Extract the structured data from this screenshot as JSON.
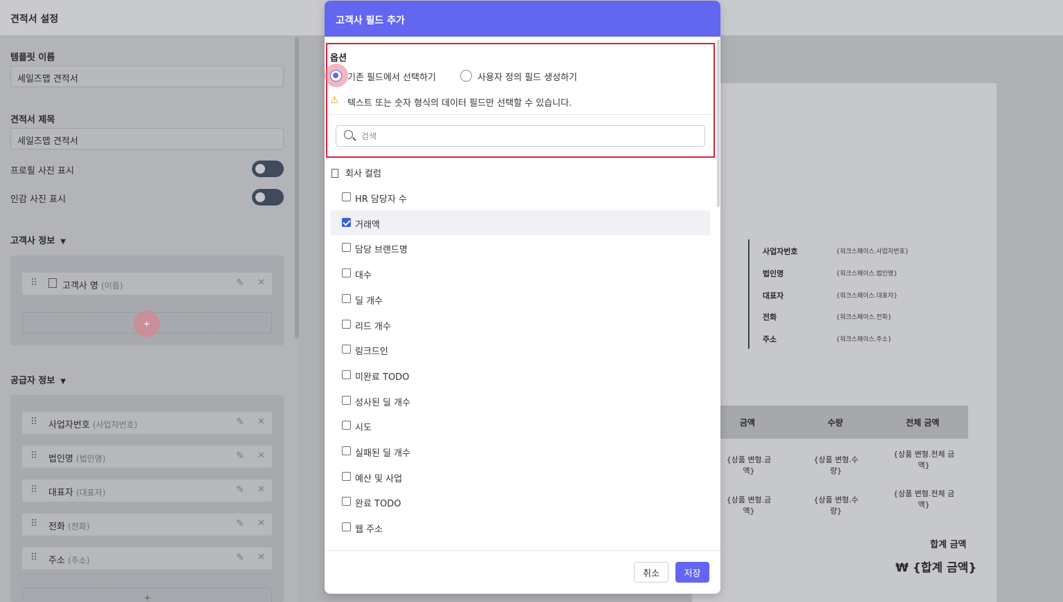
{
  "app": {
    "title": "견적서 설정"
  },
  "left": {
    "template_name_label": "템플릿 이름",
    "template_name_value": "세일즈맵 견적서",
    "quote_title_label": "견적서 제목",
    "quote_title_value": "세일즈맵 견적서",
    "toggles": [
      "프로필 사진 표시",
      "인감 사진 표시"
    ],
    "customer_section": "고객사 정보",
    "customer_fields": [
      {
        "label": "고객사 명",
        "sub": "(이름)"
      }
    ],
    "supplier_section": "공급자 정보",
    "supplier_fields": [
      {
        "label": "사업자번호",
        "sub": "(사업자번호)"
      },
      {
        "label": "법인명",
        "sub": "(법인명)"
      },
      {
        "label": "대표자",
        "sub": "(대표자)"
      },
      {
        "label": "전화",
        "sub": "(전화)"
      },
      {
        "label": "주소",
        "sub": "(주소)"
      }
    ],
    "add_symbol": "+"
  },
  "preview": {
    "supplier_info": [
      {
        "label": "사업자번호",
        "value": "{워크스페이스.사업자번호}"
      },
      {
        "label": "법인명",
        "value": "{워크스페이스.법인명}"
      },
      {
        "label": "대표자",
        "value": "{워크스페이스.대표자}"
      },
      {
        "label": "전화",
        "value": "{워크스페이스.전화}"
      },
      {
        "label": "주소",
        "value": "{워크스페이스.주소}"
      }
    ],
    "table_headers": [
      "금액",
      "수량",
      "전체 금액"
    ],
    "table_rows": [
      [
        "{상품 변형.금액}",
        "{상품 변형.수량}",
        "{상품 변형.전체 금액}"
      ],
      [
        "{상품 변형.금액}",
        "{상품 변형.수량}",
        "{상품 변형.전체 금액}"
      ]
    ],
    "total_label": "합계 금액",
    "total_value": "₩ {합계 금액}"
  },
  "modal": {
    "title": "고객사 필드 추가",
    "options_label": "옵션",
    "radio_existing": "기존 필드에서 선택하기",
    "radio_custom": "사용자 정의 필드 생성하기",
    "warning": "텍스트 또는 숫자 형식의 데이터 필드만 선택할 수 있습니다.",
    "search_placeholder": "검색",
    "group_label": "회사 컬럼",
    "items": [
      {
        "label": "HR 담당자 수",
        "checked": false
      },
      {
        "label": "거래액",
        "checked": true
      },
      {
        "label": "담당 브랜드명",
        "checked": false
      },
      {
        "label": "대수",
        "checked": false
      },
      {
        "label": "딜 개수",
        "checked": false
      },
      {
        "label": "리드 개수",
        "checked": false
      },
      {
        "label": "링크드인",
        "checked": false
      },
      {
        "label": "미완료 TODO",
        "checked": false
      },
      {
        "label": "성사된 딜 개수",
        "checked": false
      },
      {
        "label": "시도",
        "checked": false
      },
      {
        "label": "실패된 딜 개수",
        "checked": false
      },
      {
        "label": "예산 및 사업",
        "checked": false
      },
      {
        "label": "완료 TODO",
        "checked": false
      },
      {
        "label": "웹 주소",
        "checked": false
      }
    ],
    "cancel": "취소",
    "save": "저장"
  },
  "colors": {
    "accent": "#6266f0",
    "highlight": "#e01e3c",
    "checkbox": "#3b5bdb"
  },
  "icons": [
    "search-icon",
    "warning-icon",
    "building-icon",
    "drag-handle-icon",
    "pencil-icon",
    "close-icon",
    "triangle-down-icon"
  ]
}
